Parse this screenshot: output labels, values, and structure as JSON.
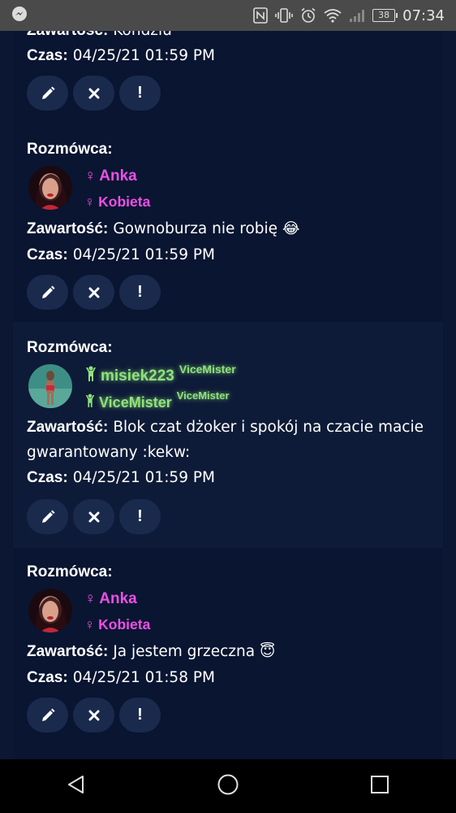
{
  "status_bar": {
    "time": "07:34",
    "battery": "38",
    "icons": [
      "messenger-icon",
      "nfc-icon",
      "vibrate-icon",
      "alarm-icon",
      "wifi-icon",
      "signal-icon",
      "battery-icon"
    ]
  },
  "labels": {
    "interlocutor": "Rozmówca:",
    "content": "Zawartość:",
    "time": "Czas:"
  },
  "messages": [
    {
      "content": "Kondziu",
      "time": "04/25/21 01:59 PM"
    },
    {
      "user_name": "Anka",
      "user_gender": "Kobieta",
      "content": "Gownoburza nie robię 😂",
      "time": "04/25/21 01:59 PM",
      "rank_color": "#ee4fe6"
    },
    {
      "user_name": "misiek223",
      "user_name_badge": "ViceMister",
      "user_gender": "ViceMister",
      "user_gender_badge": "ViceMister",
      "content": "Blok czat dżoker i spokój na czacie macie gwarantowany :kekw:",
      "time": "04/25/21 01:59 PM",
      "rank_color": "#8fe27a"
    },
    {
      "user_name": "Anka",
      "user_gender": "Kobieta",
      "content": "Ja jestem grzeczna 😇",
      "time": "04/25/21 01:58 PM",
      "rank_color": "#ee4fe6"
    }
  ],
  "buttons": {
    "edit_icon": "pencil-icon",
    "delete_icon": "close-icon",
    "report_label": "!"
  },
  "nav_bar": [
    "back-icon",
    "home-icon",
    "recents-icon"
  ]
}
